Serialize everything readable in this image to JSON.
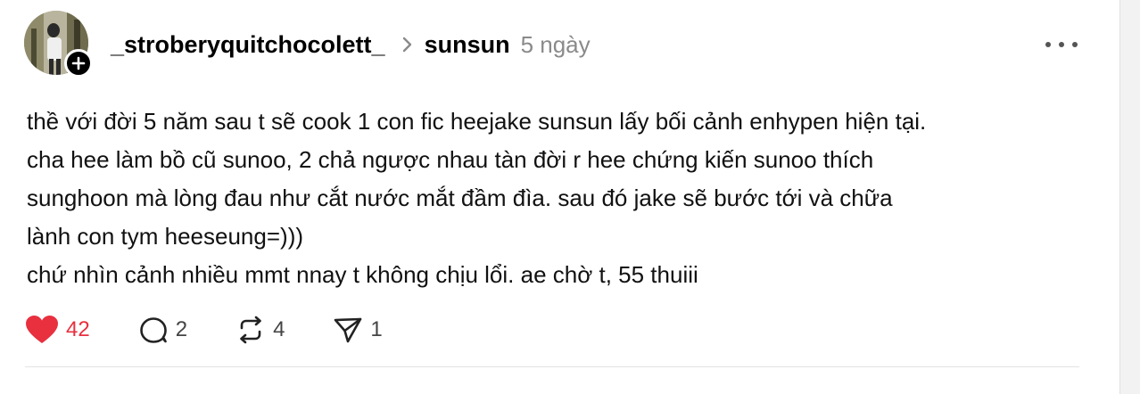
{
  "post": {
    "author": "_stroberyquitchocolett_",
    "reply_to": "sunsun",
    "time": "5 ngày",
    "lines": [
      "thề với đời 5 năm sau t sẽ cook 1 con fic heejake sunsun lấy bối cảnh enhypen hiện tại.",
      "cha hee làm bồ cũ sunoo, 2 chả ngược nhau tàn đời r hee chứng kiến sunoo thích",
      "sunghoon mà lòng đau như cắt nước mắt đầm đìa. sau đó jake sẽ bước tới và chữa",
      "lành con tym heeseung=)))",
      "chứ nhìn cảnh nhiều mmt nnay t không chịu lổi. ae chờ t, 55 thuiii"
    ]
  },
  "actions": {
    "likes": "42",
    "replies": "2",
    "reposts": "4",
    "shares": "1"
  },
  "icons": {
    "follow": "plus-icon",
    "more": "more-horizontal-icon",
    "separator": "chevron-right-icon",
    "like": "heart-icon",
    "reply": "comment-icon",
    "repost": "repost-icon",
    "share": "send-icon"
  },
  "colors": {
    "like_active": "#e8303f",
    "muted_text": "#8a8a8a",
    "primary_text": "#000000"
  }
}
